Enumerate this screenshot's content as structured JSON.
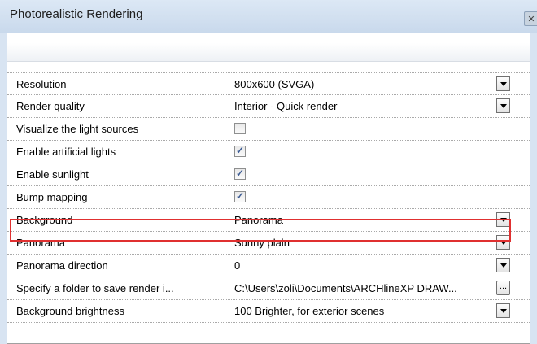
{
  "window": {
    "title": "Photorealistic Rendering",
    "close_glyph": "✕"
  },
  "properties": [
    {
      "label": "Resolution",
      "type": "dropdown",
      "value": "800x600   (SVGA)"
    },
    {
      "label": "Render quality",
      "type": "dropdown",
      "value": "Interior - Quick render"
    },
    {
      "label": "Visualize the light sources",
      "type": "checkbox",
      "checked": false
    },
    {
      "label": "Enable artificial lights",
      "type": "checkbox",
      "checked": true
    },
    {
      "label": "Enable sunlight",
      "type": "checkbox",
      "checked": true
    },
    {
      "label": "Bump mapping",
      "type": "checkbox",
      "checked": true
    },
    {
      "label": "Background",
      "type": "dropdown",
      "value": "Panorama"
    },
    {
      "label": "Panorama",
      "type": "dropdown",
      "value": "Sunny plain"
    },
    {
      "label": "Panorama direction",
      "type": "dropdown",
      "value": "0",
      "highlighted": true
    },
    {
      "label": "Specify a folder to save render i...",
      "type": "browse",
      "value": "C:\\Users\\zoli\\Documents\\ARCHlineXP DRAW...",
      "button_label": "..."
    },
    {
      "label": "Background brightness",
      "type": "dropdown",
      "value": "100 Brighter, for exterior scenes"
    }
  ],
  "colors": {
    "highlight_border": "#e03030",
    "title_bar": "#c9d9ec"
  }
}
